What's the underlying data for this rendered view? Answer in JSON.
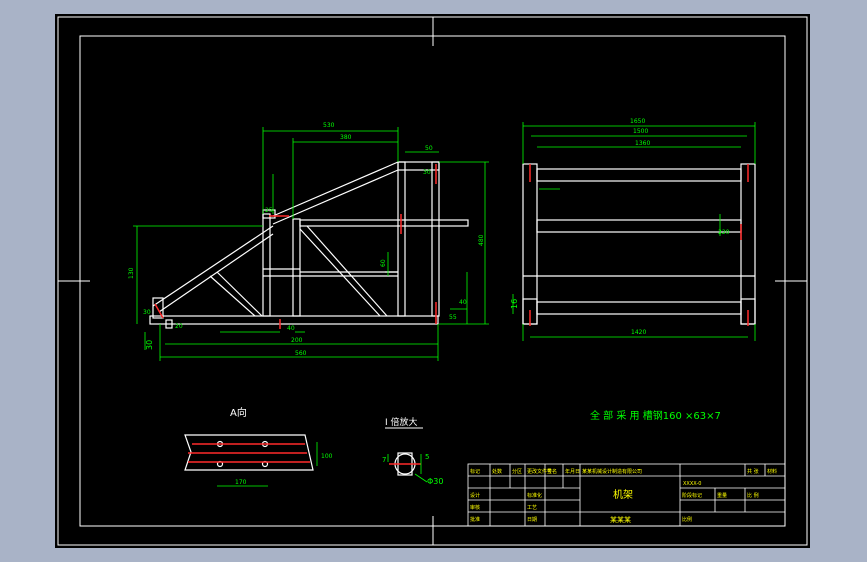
{
  "drawing": {
    "note_all_material": "全 部 采 用 槽钢160 ×63×7",
    "view_a_label": "A向",
    "detail_label": "I 倍放大",
    "detail_dim_5": "5",
    "detail_dim_7": "7",
    "detail_dim_diameter": "Φ30",
    "side_view": {
      "dim_top_overall": "530",
      "dim_top_inner": "380",
      "dim_small_right": "50",
      "dim_left_height": "130",
      "dim_left_bottom": "30",
      "dim_bottom_mid": "200",
      "dim_bottom_overall": "560",
      "dim_right_height": "480",
      "dim_small_a": "30",
      "dim_small_b": "60",
      "dim_small_c": "40",
      "dim_small_d": "55",
      "dim_small_e": "25",
      "dim_small_f": "40",
      "dim_small_g": "20",
      "dim_small_h": "30"
    },
    "front_view": {
      "dim_top_overall": "1650",
      "dim_top_second": "1500",
      "dim_top_third": "1360",
      "dim_left_small": "16",
      "dim_bottom": "1420",
      "dim_mid_right": "220"
    },
    "a_view": {
      "dim_right": "100",
      "dim_bottom": "170"
    },
    "title_block": {
      "drawing_name": "机架",
      "project": "某某机械设计制造有限公司",
      "drawing_no": "XXXX-0",
      "company": "某某某",
      "scale_label": "比例",
      "sheet_label": "共 张",
      "weight_label": "重量",
      "material_label": "材料",
      "designer_label": "设计",
      "checker_label": "审核",
      "approver_label": "批准",
      "date_label": "日期",
      "std_label": "标准化",
      "process_label": "工艺",
      "mark_label": "标记",
      "count_label": "处数",
      "zone_label": "分区",
      "change_label": "更改文件号",
      "sign_label": "签名",
      "ymd_label": "年月日",
      "stage_label": "阶段标记",
      "ratio_label": "比 例"
    }
  },
  "colors": {
    "background": "#a9b3c7",
    "paper": "#000000",
    "frame": "#ffffff",
    "geometry": "#ffffff",
    "dimension": "#00ff00",
    "accent_red": "#ff2a2a",
    "accent_yellow": "#ffff00",
    "title_text": "#ffff00"
  }
}
